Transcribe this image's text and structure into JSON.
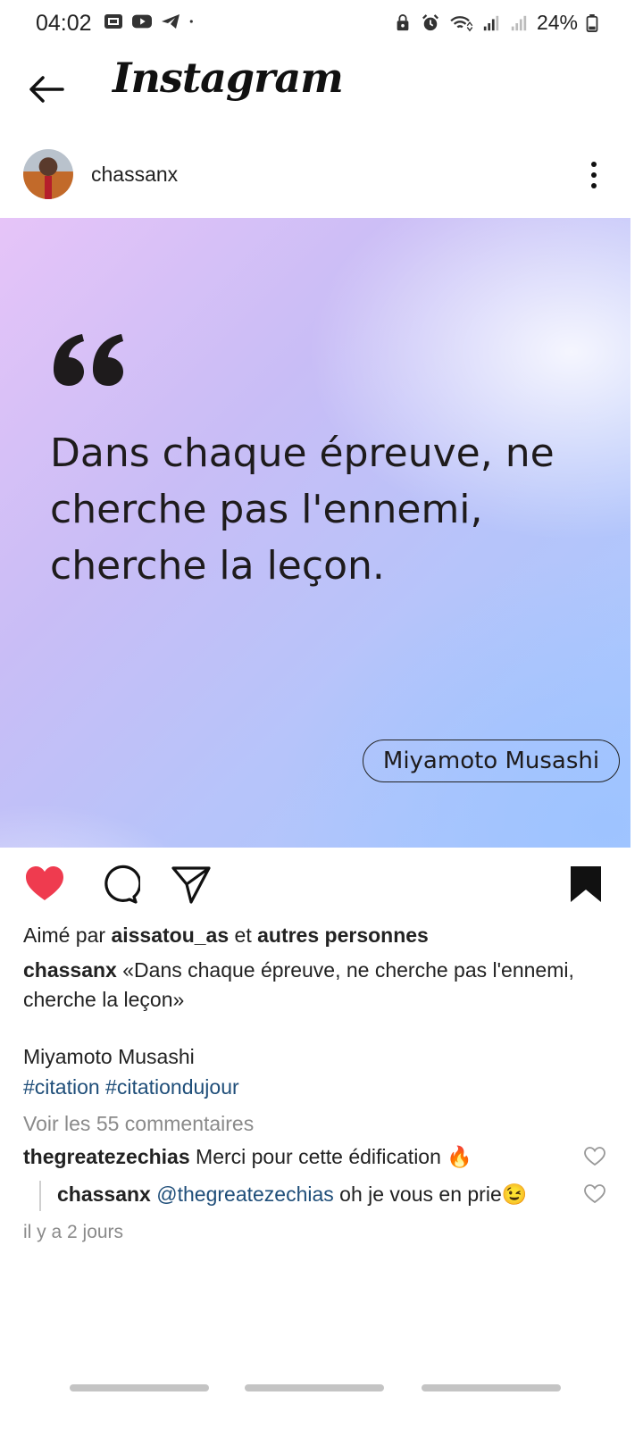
{
  "status_bar": {
    "time": "04:02",
    "battery": "24%",
    "left_icons": [
      "screenshot-icon",
      "youtube-icon",
      "telegram-icon",
      "dot-icon"
    ],
    "right_icons": [
      "vpn-lock-icon",
      "alarm-icon",
      "wifi-icon",
      "signal-icon",
      "signal-icon",
      "battery-icon"
    ]
  },
  "header": {
    "title": "Instagram",
    "back_icon": "arrow-left-icon"
  },
  "post": {
    "username": "chassanx",
    "image": {
      "quote": "Dans chaque épreuve, ne cherche pas l'ennemi, cherche la leçon.",
      "author": "Miyamoto Musashi",
      "gradient_colors": [
        "#e6c4f8",
        "#c9bdf6",
        "#b6c4fa",
        "#a8c9ff"
      ]
    },
    "liked": true,
    "saved": true,
    "like_color": "#ef3b4f",
    "likes_prefix": "Aimé par",
    "likes_user": "aissatou_as",
    "likes_mid": "et",
    "likes_rest": "autres personnes",
    "caption_user": "chassanx",
    "caption_text": "«Dans chaque épreuve, ne cherche pas l'ennemi, cherche la leçon»",
    "caption_author": "Miyamoto Musashi",
    "hashtags": "#citation #citationdujour",
    "view_comments": "Voir les 55 commentaires",
    "comments": [
      {
        "user": "thegreatezechias",
        "text": "Merci pour cette édification 🔥"
      },
      {
        "user": "chassanx",
        "mention": "@thegreatezechias",
        "text": "oh je vous en prie😉"
      }
    ],
    "time_ago": "il y a 2 jours"
  },
  "colors": {
    "link": "#1f4e79",
    "muted": "#8a8a8a",
    "heart": "#ef3b4f"
  }
}
